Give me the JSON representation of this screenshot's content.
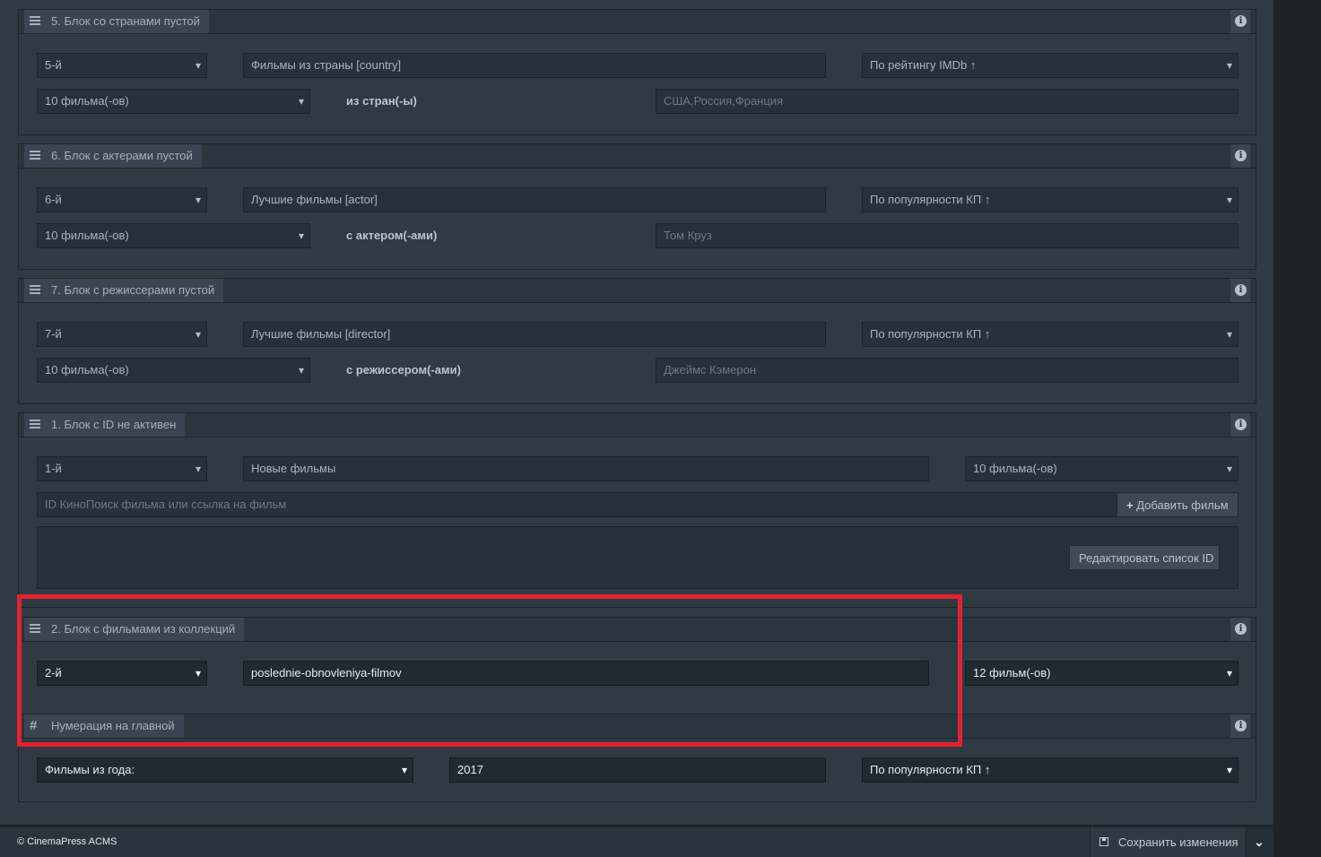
{
  "blocks": [
    {
      "title": "5. Блок со странами пустой",
      "position": "5-й",
      "name_value": "Фильмы из страны [country]",
      "sort": "По рейтингу IMDb ↑",
      "count": "10 фильма(-ов)",
      "filter_label": "из стран(-ы)",
      "filter_placeholder": "США,Россия,Франция"
    },
    {
      "title": "6. Блок с актерами пустой",
      "position": "6-й",
      "name_value": "Лучшие фильмы [actor]",
      "sort": "По популярности КП ↑",
      "count": "10 фильма(-ов)",
      "filter_label": "с актером(-ами)",
      "filter_placeholder": "Том Круз"
    },
    {
      "title": "7. Блок с режиссерами пустой",
      "position": "7-й",
      "name_value": "Лучшие фильмы [director]",
      "sort": "По популярности КП ↑",
      "count": "10 фильма(-ов)",
      "filter_label": "с режиссером(-ами)",
      "filter_placeholder": "Джеймс Кэмерон"
    }
  ],
  "id_block": {
    "title": "1. Блок с ID не активен",
    "position": "1-й",
    "name_value": "Новые фильмы",
    "count": "10 фильма(-ов)",
    "id_placeholder": "ID КиноПоиск фильма или ссылка на фильм",
    "add_button": "Добавить фильм",
    "edit_button": "Редактировать список ID"
  },
  "collection_block": {
    "title": "2. Блок с фильмами из коллекций",
    "position": "2-й",
    "collection_value": "poslednie-obnovleniya-filmov",
    "count": "12 фильм(-ов)"
  },
  "numbering_block": {
    "title": "Нумерация на главной",
    "mode": "Фильмы из года:",
    "year": "2017",
    "sort": "По популярности КП ↑"
  },
  "footer": {
    "copyright": "© CinemaPress ACMS",
    "save_label": "Сохранить изменения"
  },
  "colors": {
    "background": "#2f3a43",
    "highlight_border": "#e3222e"
  },
  "icons": [
    "menu-icon",
    "info-icon",
    "hash-icon",
    "plus-icon",
    "save-icon",
    "chevron-down-icon",
    "dropdown-arrow-icon"
  ]
}
